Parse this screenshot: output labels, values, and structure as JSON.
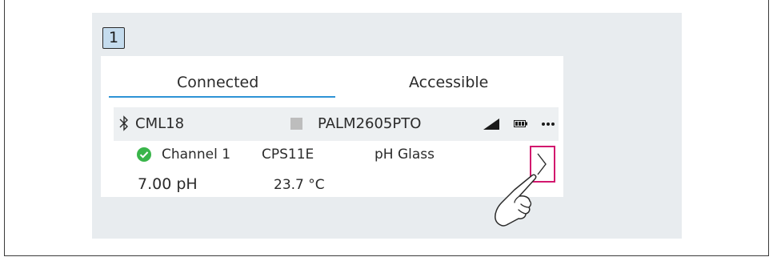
{
  "step": {
    "number": "1"
  },
  "tabs": [
    {
      "label": "Connected",
      "active": true
    },
    {
      "label": "Accessible",
      "active": false
    }
  ],
  "device": {
    "name": "CML18",
    "tag": "PALM2605PTO",
    "icons": [
      "bluetooth-icon",
      "status-square-icon",
      "signal-icon",
      "battery-icon",
      "more-icon"
    ]
  },
  "measurement": {
    "channel": "Channel 1",
    "sensor": "CPS11E",
    "type": "pH Glass",
    "value": "7.00 pH",
    "temperature": "23.7 °C",
    "status_icon": "check-circle-icon"
  },
  "colors": {
    "accent": "#2e93d6",
    "ok_green": "#39b54a",
    "highlight_magenta": "#d2186e",
    "badge_bg": "#c5dcee",
    "panel_bg": "#e8ecef"
  }
}
